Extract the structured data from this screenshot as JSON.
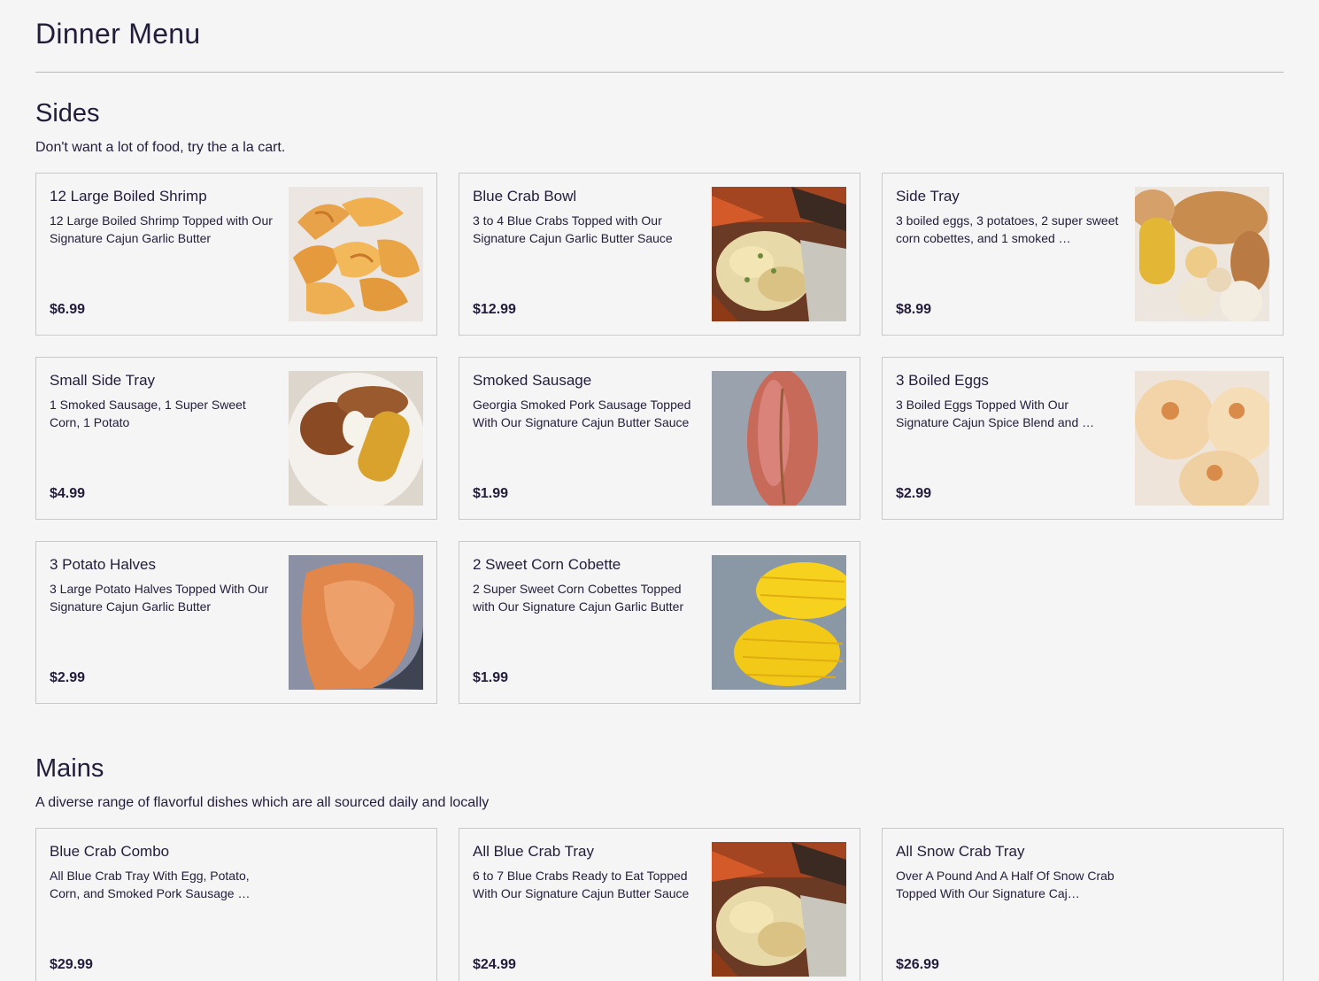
{
  "page": {
    "title": "Dinner Menu"
  },
  "sides": {
    "title": "Sides",
    "description": "Don't want a lot of food, try the a la cart.",
    "items": [
      {
        "name": "12 Large Boiled Shrimp",
        "description": "12 Large Boiled Shrimp Topped with Our Signature Cajun Garlic Butter",
        "price": "$6.99",
        "image": "shrimp"
      },
      {
        "name": "Blue Crab Bowl",
        "description": "3 to 4 Blue Crabs Topped with Our Signature Cajun Garlic Butter Sauce",
        "price": "$12.99",
        "image": "crab"
      },
      {
        "name": "Side Tray",
        "description": "3 boiled eggs, 3 potatoes, 2 super sweet corn cobettes, and 1 smoked …",
        "price": "$8.99",
        "image": "sidetray"
      },
      {
        "name": "Small Side Tray",
        "description": "1 Smoked Sausage, 1 Super Sweet Corn, 1 Potato",
        "price": "$4.99",
        "image": "smalltray"
      },
      {
        "name": "Smoked Sausage",
        "description": "Georgia Smoked Pork Sausage Topped With Our Signature Cajun Butter Sauce",
        "price": "$1.99",
        "image": "sausage"
      },
      {
        "name": "3 Boiled Eggs",
        "description": "3 Boiled Eggs Topped With Our Signature Cajun Spice Blend and …",
        "price": "$2.99",
        "image": "eggs"
      },
      {
        "name": "3 Potato Halves",
        "description": "3 Large Potato Halves Topped With Our Signature Cajun Garlic Butter",
        "price": "$2.99",
        "image": "potato"
      },
      {
        "name": "2 Sweet Corn Cobette",
        "description": "2 Super Sweet Corn Cobettes Topped with Our Signature Cajun Garlic Butter",
        "price": "$1.99",
        "image": "corn"
      }
    ]
  },
  "mains": {
    "title": "Mains",
    "description": "A diverse range of flavorful dishes which are all sourced daily and locally",
    "items": [
      {
        "name": "Blue Crab Combo",
        "description": "All Blue Crab Tray With Egg, Potato, Corn, and Smoked Pork Sausage …",
        "price": "$29.99",
        "image": ""
      },
      {
        "name": "All Blue Crab Tray",
        "description": "6 to 7 Blue Crabs Ready to Eat Topped With Our Signature Cajun Butter Sauce",
        "price": "$24.99",
        "image": "crab"
      },
      {
        "name": "All Snow Crab Tray",
        "description": "Over A Pound And A Half Of Snow Crab Topped With Our Signature Caj…",
        "price": "$26.99",
        "image": ""
      }
    ]
  }
}
